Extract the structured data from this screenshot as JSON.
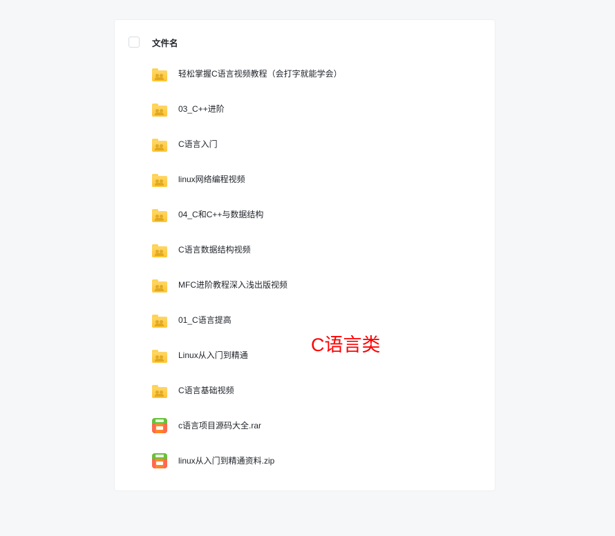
{
  "header": {
    "column_label": "文件名"
  },
  "files": [
    {
      "type": "folder",
      "name": "轻松掌握C语言视频教程（会打字就能学会）"
    },
    {
      "type": "folder",
      "name": "03_C++进阶"
    },
    {
      "type": "folder",
      "name": "C语言入门"
    },
    {
      "type": "folder",
      "name": "linux网络编程视频"
    },
    {
      "type": "folder",
      "name": "04_C和C++与数据结构"
    },
    {
      "type": "folder",
      "name": "C语言数据结构视频"
    },
    {
      "type": "folder",
      "name": "MFC进阶教程深入浅出版视频"
    },
    {
      "type": "folder",
      "name": "01_C语言提高"
    },
    {
      "type": "folder",
      "name": "Linux从入门到精通"
    },
    {
      "type": "folder",
      "name": "C语言基础视频"
    },
    {
      "type": "archive",
      "name": "c语言项目源码大全.rar"
    },
    {
      "type": "archive",
      "name": "linux从入门到精通资料.zip"
    }
  ],
  "overlay": {
    "category_label": "C语言类"
  }
}
